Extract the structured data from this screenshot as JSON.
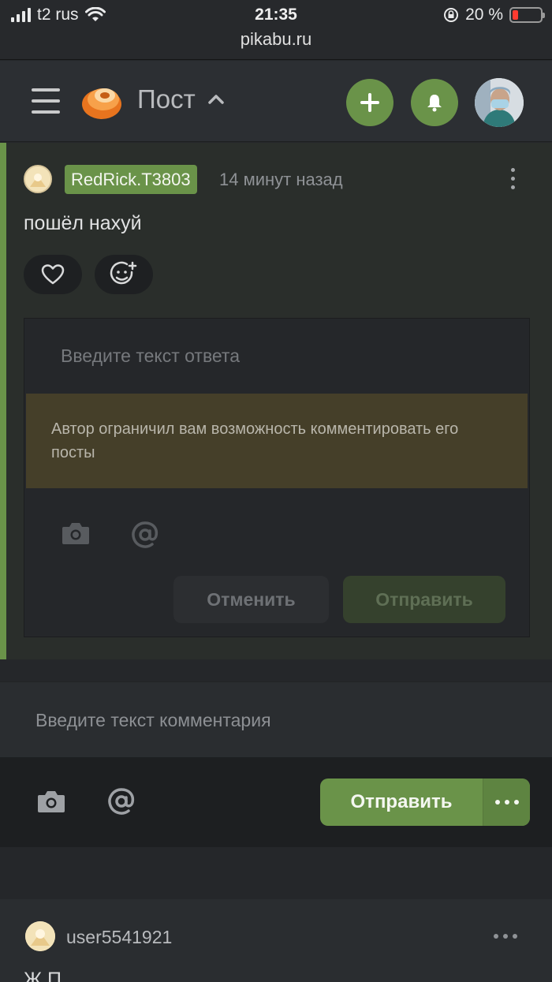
{
  "status_bar": {
    "carrier": "t2 rus",
    "time": "21:35",
    "url": "pikabu.ru",
    "battery": "20 %",
    "battery_level": 0.2
  },
  "header": {
    "title": "Пост"
  },
  "comment": {
    "username": "RedRick.T3803",
    "time": "14 минут назад",
    "text": "пошёл нахуй",
    "reply_placeholder": "Введите текст ответа",
    "warning": "Автор ограничил вам возможность комментировать его посты",
    "cancel_label": "Отменить",
    "send_label": "Отправить"
  },
  "main_comment": {
    "placeholder": "Введите текст комментария",
    "send_label": "Отправить"
  },
  "next_comment": {
    "username": "user5541921",
    "text_partial": "Ж       П"
  },
  "colors": {
    "accent": "#6a9349",
    "background": "#25272a",
    "warning_bg": "#453f29"
  }
}
